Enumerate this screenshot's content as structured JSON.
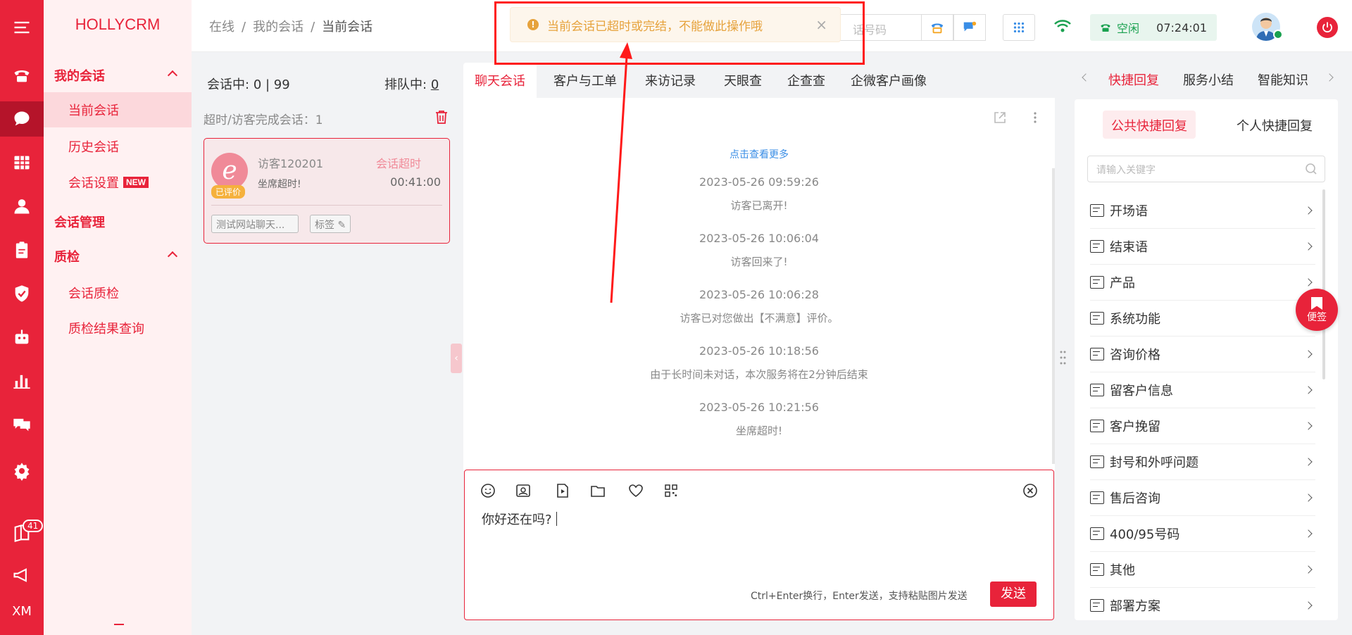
{
  "rail": {
    "icons": [
      "menu-icon",
      "phone-icon",
      "chat-icon",
      "grid-icon",
      "user-icon",
      "clipboard-icon",
      "shield-icon",
      "robot-icon",
      "chart-icon",
      "message-icon",
      "settings-icon",
      "book-icon",
      "megaphone-icon"
    ],
    "badge": "41",
    "footer": "XM"
  },
  "nav": {
    "brand": "HOLLYCRM",
    "groups": [
      {
        "label": "我的会话",
        "items": [
          "当前会话",
          "历史会话",
          "会话设置"
        ]
      },
      {
        "label": "会话管理",
        "items": []
      },
      {
        "label": "质检",
        "items": [
          "会话质检",
          "质检结果查询"
        ]
      }
    ],
    "new_badge": "NEW"
  },
  "header": {
    "breadcrumb": [
      "在线",
      "我的会话",
      "当前会话"
    ],
    "separator": "/",
    "search_placeholder_fragment": "话号码",
    "status": "空闲",
    "time": "07:24:01"
  },
  "toast": {
    "message": "当前会话已超时或完结，不能做此操作哦",
    "close": "×"
  },
  "sessions": {
    "in_session_label": "会话中:",
    "in_session_value": "0 | 99",
    "queue_label": "排队中:",
    "queue_value": "0",
    "timeout_label": "超时/访客完成会话：1",
    "card": {
      "name": "访客120201",
      "state": "会话超时",
      "rated": "已评价",
      "last_message": "坐席超时!",
      "duration": "00:41:00",
      "source_tag": "测试网站聊天...",
      "tag_label": "标签"
    }
  },
  "chat": {
    "tabs": [
      "聊天会话",
      "客户与工单",
      "来访记录",
      "天眼查",
      "企查查",
      "企微客户画像"
    ],
    "active_tab": 0,
    "more_link": "点击查看更多",
    "messages": [
      {
        "time": "2023-05-26 09:59:26",
        "text": "访客已离开!"
      },
      {
        "time": "2023-05-26 10:06:04",
        "text": "访客回来了!"
      },
      {
        "time": "2023-05-26 10:06:28",
        "text": "访客已对您做出【不满意】评价。"
      },
      {
        "time": "2023-05-26 10:18:56",
        "text": "由于长时间未对话，本次服务将在2分钟后结束"
      },
      {
        "time": "2023-05-26 10:21:56",
        "text": "坐席超时!"
      }
    ],
    "composer": {
      "text": "你好还在吗?",
      "hint": "Ctrl+Enter换行，Enter发送，支持粘贴图片发送",
      "send": "发送"
    }
  },
  "right": {
    "tabs": [
      "快捷回复",
      "服务小结",
      "智能知识"
    ],
    "active_tab": 0,
    "subtabs": [
      "公共快捷回复",
      "个人快捷回复"
    ],
    "search_placeholder": "请输入关键字",
    "items": [
      "开场语",
      "结束语",
      "产品",
      "系统功能",
      "咨询价格",
      "留客户信息",
      "客户挽留",
      "封号和外呼问题",
      "售后咨询",
      "400/95号码",
      "其他",
      "部署方案"
    ],
    "sticky": "便签"
  },
  "colors": {
    "brand": "#e8233a",
    "toast_text": "#e6a23c",
    "status_green": "#1aa150",
    "link_blue": "#3a8ee6",
    "annotation_red": "#ff1a1a"
  }
}
